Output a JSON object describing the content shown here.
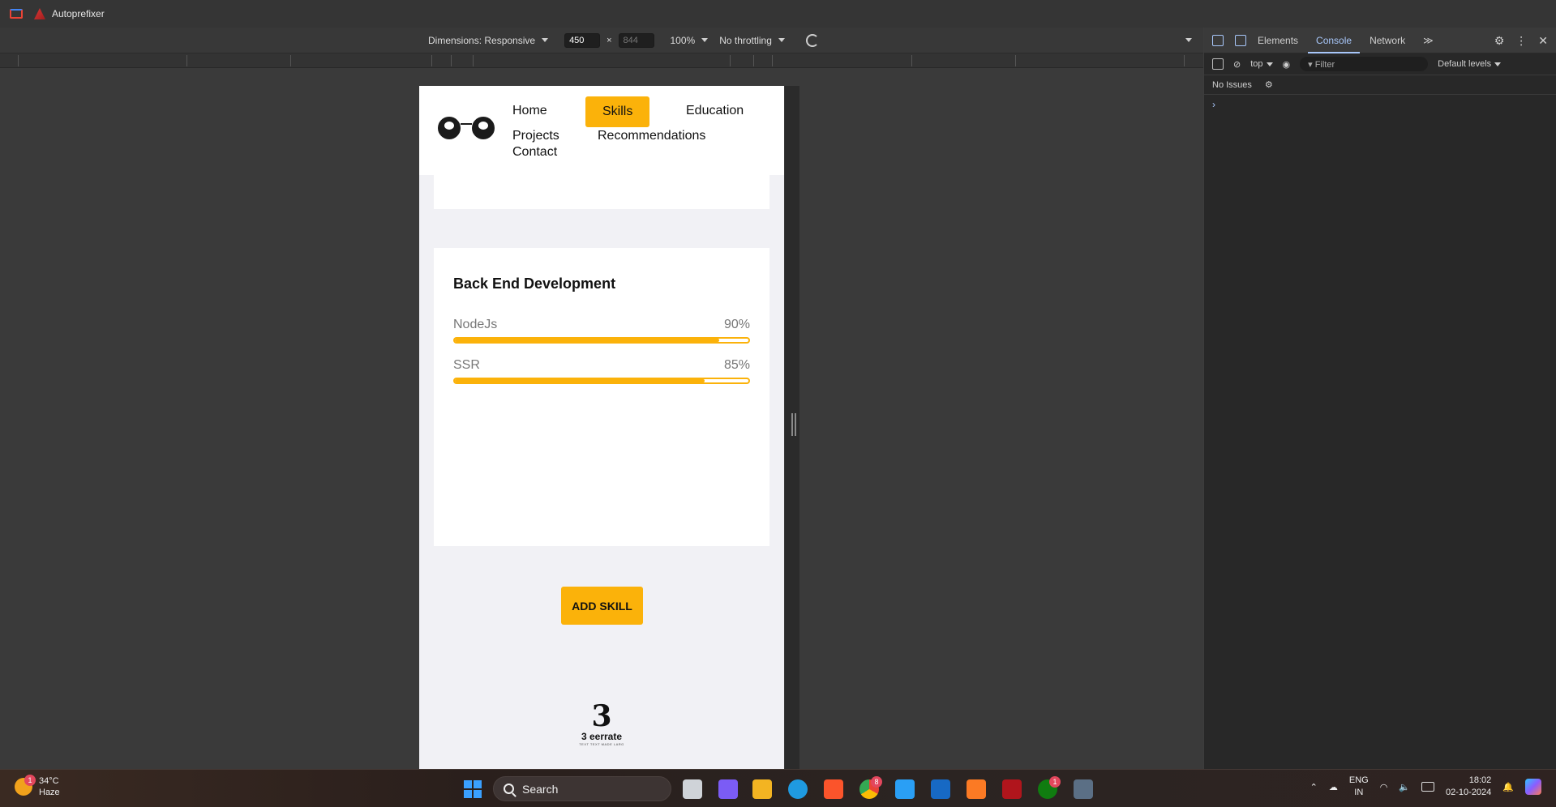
{
  "topbar": {
    "bookmarks": [
      {
        "label": ""
      },
      {
        "label": "Autoprefixer"
      }
    ]
  },
  "device_toolbar": {
    "dimensions_label": "Dimensions: Responsive",
    "width": "450",
    "times": "×",
    "height": "844",
    "zoom": "100%",
    "throttling": "No throttling"
  },
  "page": {
    "nav": {
      "home": "Home",
      "skills": "Skills",
      "education": "Education",
      "projects": "Projects",
      "recommendations": "Recommendations",
      "contact": "Contact"
    },
    "card": {
      "title": "Back End Development",
      "skills": [
        {
          "name": "NodeJs",
          "percent_label": "90%",
          "percent": 90
        },
        {
          "name": "SSR",
          "percent_label": "85%",
          "percent": 85
        }
      ]
    },
    "add_button": "ADD SKILL",
    "brand": {
      "mark": "3",
      "name": "3 eerrate",
      "tagline": "TEXT TEXT MADE LARG"
    }
  },
  "devtools": {
    "tabs": [
      "Elements",
      "Console",
      "Network"
    ],
    "active_tab": "Console",
    "more": "≫",
    "context": "top",
    "filter_placeholder": "Filter",
    "levels": "Default levels",
    "issues": "No Issues",
    "prompt": "›"
  },
  "taskbar": {
    "weather_temp": "34°C",
    "weather_desc": "Haze",
    "weather_badge": "1",
    "search_label": "Search",
    "language": "ENG",
    "region": "IN",
    "time": "18:02",
    "date": "02-10-2024",
    "chrome_badge": "8",
    "xbox_badge": "1"
  },
  "colors": {
    "accent": "#fbb20a",
    "devtools_blue": "#a8c7fa"
  }
}
